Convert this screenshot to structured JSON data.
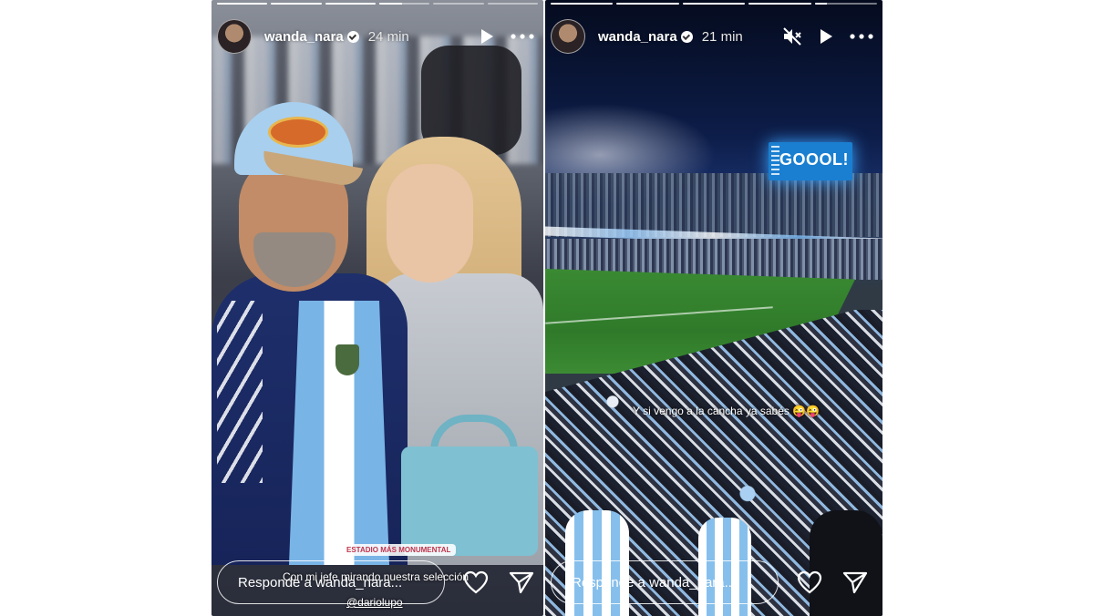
{
  "stories": [
    {
      "username": "wanda_nara",
      "time": "24 min",
      "reply_placeholder": "Responde a wanda_nara...",
      "caption": "Con mi jefe mirando nuestra selección",
      "location": "ESTADIO MÁS MONUMENTAL",
      "mention": "@dariolupo",
      "progress": [
        1,
        1,
        1,
        0.45,
        0,
        0
      ],
      "icons": [
        "play-icon",
        "more-icon",
        "heart-icon",
        "send-icon"
      ]
    },
    {
      "username": "wanda_nara",
      "time": "21 min",
      "reply_placeholder": "Responde a wanda_nara...",
      "caption": "Y si vengo a la cancha ya sabés 😜😜",
      "scoreboard": "GOOOL!",
      "progress": [
        1,
        1,
        1,
        1,
        0.2
      ],
      "icons": [
        "mute-icon",
        "play-icon",
        "more-icon",
        "heart-icon",
        "send-icon"
      ]
    }
  ],
  "colors": {
    "text": "#ffffff",
    "scoreboard": "#1a7fd0",
    "location_text": "#c0324a"
  }
}
